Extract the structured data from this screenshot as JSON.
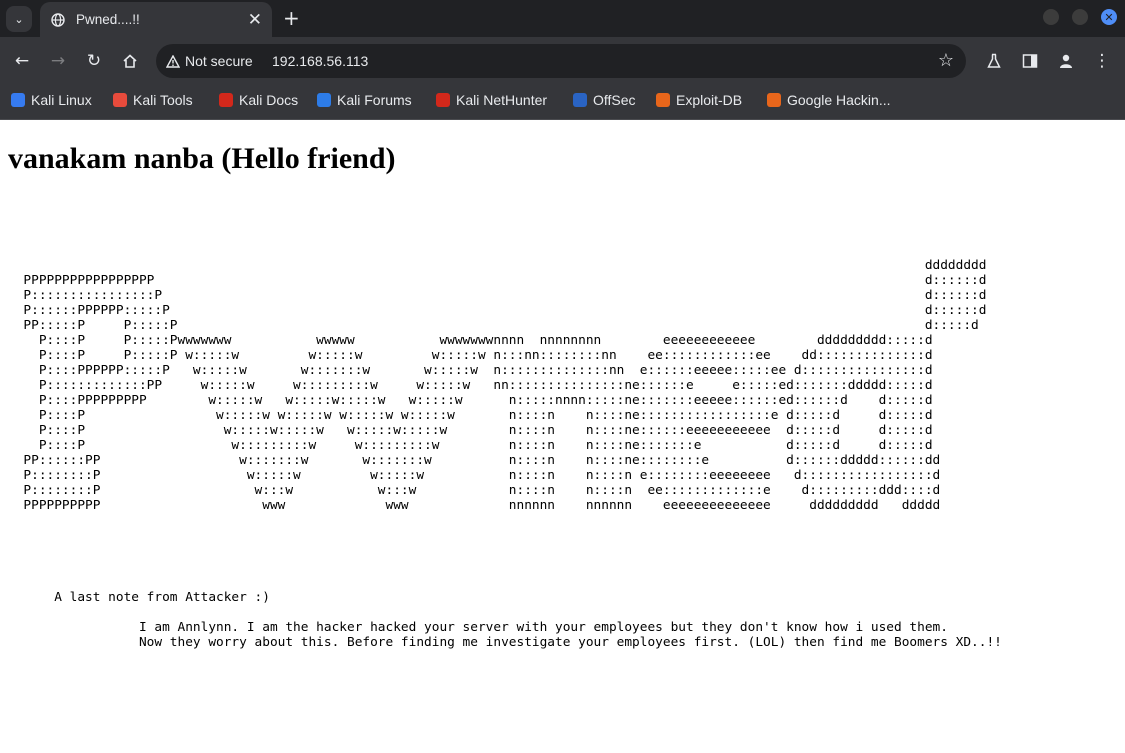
{
  "browser": {
    "tab": {
      "title": "Pwned....!!"
    },
    "address": {
      "security_label": "Not secure",
      "url": "192.168.56.113"
    },
    "bookmarks": [
      {
        "label": "Kali Linux",
        "color": "#367bf0"
      },
      {
        "label": "Kali Tools",
        "color": "#e84b3c"
      },
      {
        "label": "Kali Docs",
        "color": "#d3281b"
      },
      {
        "label": "Kali Forums",
        "color": "#2d7ce8"
      },
      {
        "label": "Kali NetHunter",
        "color": "#d3281b"
      },
      {
        "label": "OffSec",
        "color": "#2a64c4"
      },
      {
        "label": "Exploit-DB",
        "color": "#e8661b"
      },
      {
        "label": "Google Hackin...",
        "color": "#e8661b"
      }
    ]
  },
  "page": {
    "heading": "vanakam nanba (Hello friend)",
    "ascii_art": "                                                                                                                       dddddddd\n  PPPPPPPPPPPPPPPPP                                                                                                    d::::::d\n  P::::::::::::::::P                                                                                                   d::::::d\n  P::::::PPPPPP:::::P                                                                                                  d::::::d\n  PP:::::P     P:::::P                                                                                                 d:::::d\n    P::::P     P:::::Pwwwwwww           wwwww           wwwwwwwnnnn  nnnnnnnn        eeeeeeeeeeee        ddddddddd:::::d\n    P::::P     P:::::P w:::::w         w:::::w         w:::::w n:::nn::::::::nn    ee::::::::::::ee    dd::::::::::::::d\n    P::::PPPPPP:::::P   w:::::w       w:::::::w       w:::::w  n::::::::::::::nn  e::::::eeeee:::::ee d::::::::::::::::d\n    P:::::::::::::PP     w:::::w     w:::::::::w     w:::::w   nn:::::::::::::::ne::::::e     e:::::ed:::::::ddddd:::::d\n    P::::PPPPPPPPP        w:::::w   w:::::w:::::w   w:::::w      n:::::nnnn:::::ne:::::::eeeee::::::ed::::::d    d:::::d\n    P::::P                 w:::::w w:::::w w:::::w w:::::w       n::::n    n::::ne:::::::::::::::::e d:::::d     d:::::d\n    P::::P                  w:::::w:::::w   w:::::w:::::w        n::::n    n::::ne::::::eeeeeeeeeee  d:::::d     d:::::d\n    P::::P                   w:::::::::w     w:::::::::w         n::::n    n::::ne:::::::e           d:::::d     d:::::d\n  PP::::::PP                  w:::::::w       w:::::::w          n::::n    n::::ne::::::::e          d::::::ddddd::::::dd\n  P::::::::P                   w:::::w         w:::::w           n::::n    n::::n e::::::::eeeeeeee   d:::::::::::::::::d\n  P::::::::P                    w:::w           w:::w            n::::n    n::::n  ee:::::::::::::e    d:::::::::ddd::::d\n  PPPPPPPPPP                     www             www             nnnnnn    nnnnnn    eeeeeeeeeeeeee     ddddddddd   ddddd",
    "note": "      A last note from Attacker :)\n\n                 I am Annlynn. I am the hacker hacked your server with your employees but they don't know how i used them.\n                 Now they worry about this. Before finding me investigate your employees first. (LOL) then find me Boomers XD..!!"
  }
}
